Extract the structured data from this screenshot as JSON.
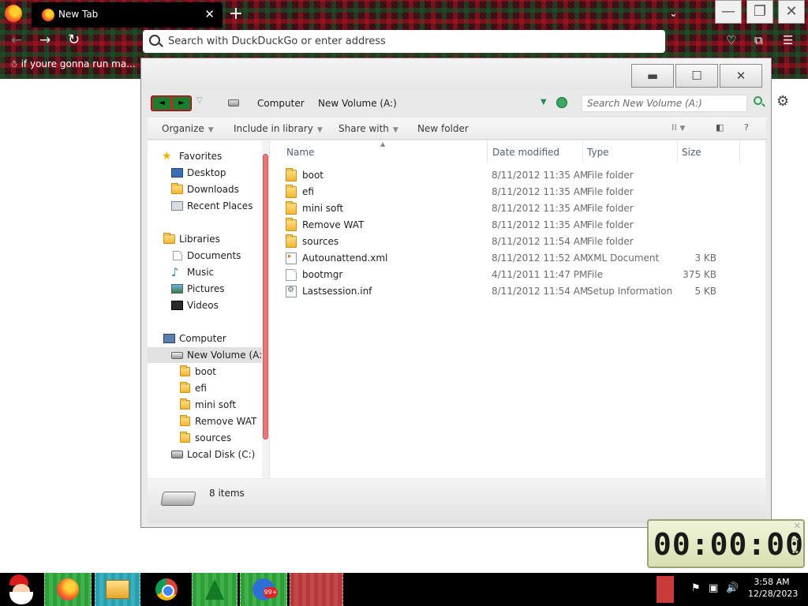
{
  "browser": {
    "tab_title": "New Tab",
    "tab_close": "✕",
    "new_tab": "+",
    "url_placeholder": "Search with DuckDuckGo or enter address",
    "bookmark_label": "if youre gonna run ma..."
  },
  "explorer": {
    "breadcrumb": [
      "Computer",
      "New Volume (A:)"
    ],
    "search_placeholder": "Search New Volume (A:)",
    "commands": {
      "organize": "Organize",
      "include_in_library": "Include in library",
      "share_with": "Share with",
      "new_folder": "New folder"
    },
    "nav": {
      "favorites": "Favorites",
      "desktop": "Desktop",
      "downloads": "Downloads",
      "recent_places": "Recent Places",
      "libraries": "Libraries",
      "documents": "Documents",
      "music": "Music",
      "pictures": "Pictures",
      "videos": "Videos",
      "computer": "Computer",
      "new_volume": "New Volume (A:)",
      "sub": [
        "boot",
        "efi",
        "mini soft",
        "Remove WAT",
        "sources"
      ],
      "local_disk": "Local Disk (C:)"
    },
    "columns": {
      "name": "Name",
      "date_modified": "Date modified",
      "type": "Type",
      "size": "Size"
    },
    "files": [
      {
        "name": "boot",
        "modified": "8/11/2012 11:35 AM",
        "type": "File folder",
        "size": "",
        "icon": "folder-icon"
      },
      {
        "name": "efi",
        "modified": "8/11/2012 11:35 AM",
        "type": "File folder",
        "size": "",
        "icon": "folder-icon"
      },
      {
        "name": "mini soft",
        "modified": "8/11/2012 11:35 AM",
        "type": "File folder",
        "size": "",
        "icon": "folder-icon"
      },
      {
        "name": "Remove WAT",
        "modified": "8/11/2012 11:35 AM",
        "type": "File folder",
        "size": "",
        "icon": "folder-icon"
      },
      {
        "name": "sources",
        "modified": "8/11/2012 11:54 AM",
        "type": "File folder",
        "size": "",
        "icon": "folder-icon"
      },
      {
        "name": "Autounattend.xml",
        "modified": "8/11/2012 11:52 AM",
        "type": "XML Document",
        "size": "3 KB",
        "icon": "xml-file-icon"
      },
      {
        "name": "bootmgr",
        "modified": "4/11/2011 11:47 PM",
        "type": "File",
        "size": "375 KB",
        "icon": "file-icon"
      },
      {
        "name": "Lastsession.inf",
        "modified": "8/11/2012 11:54 AM",
        "type": "Setup Information",
        "size": "5 KB",
        "icon": "inf-file-icon"
      }
    ],
    "status": "8 items"
  },
  "clock": {
    "time": "00:00:00"
  },
  "taskbar": {
    "badge": "99+",
    "time": "3:58 AM",
    "date": "12/28/2023"
  },
  "colors": {
    "plaid_base": "#3a0d14",
    "scroll_thumb": "#e37a7a",
    "tile_green": "#2e9e3a",
    "tile_red": "#b33a3a",
    "tile_blue": "#2b9fae"
  }
}
